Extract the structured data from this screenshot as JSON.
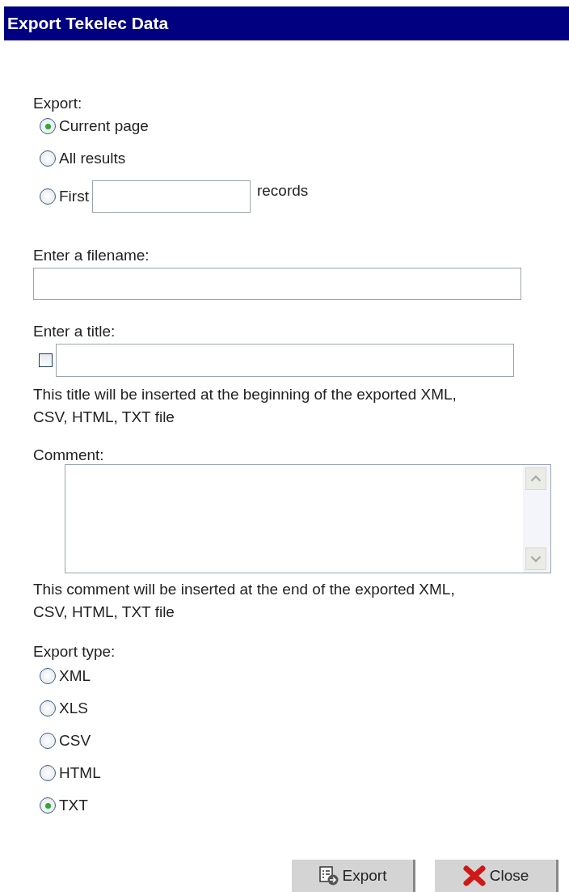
{
  "window": {
    "title": "Export Tekelec Data"
  },
  "export": {
    "label": "Export:",
    "options": [
      {
        "label": "Current page",
        "selected": true
      },
      {
        "label": "All results",
        "selected": false
      },
      {
        "label": "First",
        "selected": false,
        "kind": "count",
        "suffix": "records"
      }
    ]
  },
  "filename": {
    "label": "Enter a filename:"
  },
  "title": {
    "label": "Enter a title:",
    "checked": false,
    "help": "This title will be inserted at the beginning of the exported XML, CSV, HTML, TXT file"
  },
  "comment": {
    "label": "Comment:",
    "help": "This comment will be inserted at the end of the exported XML, CSV, HTML, TXT file"
  },
  "export_type": {
    "label": "Export type:",
    "options": [
      {
        "label": "XML",
        "selected": false
      },
      {
        "label": "XLS",
        "selected": false
      },
      {
        "label": "CSV",
        "selected": false
      },
      {
        "label": "HTML",
        "selected": false
      },
      {
        "label": "TXT",
        "selected": true
      }
    ]
  },
  "buttons": [
    {
      "label": "Export",
      "kind": "export"
    },
    {
      "label": "Close",
      "kind": "close"
    }
  ]
}
